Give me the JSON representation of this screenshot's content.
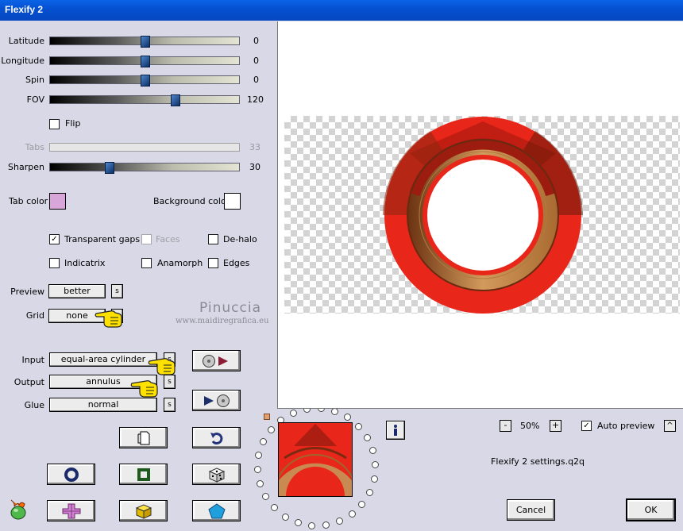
{
  "window": {
    "title": "Flexify 2"
  },
  "sliders": [
    {
      "label": "Latitude",
      "value": "0",
      "position": 0.5
    },
    {
      "label": "Longitude",
      "value": "0",
      "position": 0.5
    },
    {
      "label": "Spin",
      "value": "0",
      "position": 0.5
    },
    {
      "label": "FOV",
      "value": "120",
      "position": 0.66
    }
  ],
  "flip": {
    "label": "Flip",
    "checked": false
  },
  "tabs": {
    "label": "Tabs",
    "value": "33",
    "disabled": true
  },
  "sharpen": {
    "label": "Sharpen",
    "value": "30",
    "position": 0.3
  },
  "colors": {
    "tab_color_label": "Tab color",
    "tab_color": "#d9a6da",
    "background_color_label": "Background color",
    "background_color": "#ffffff"
  },
  "options": {
    "transparent_gaps": "Transparent gaps",
    "faces": "Faces",
    "de_halo": "De-halo",
    "indicatrix": "Indicatrix",
    "anamorph": "Anamorph",
    "edges": "Edges"
  },
  "preview_mode": {
    "label": "Preview",
    "value": "better"
  },
  "grid": {
    "label": "Grid",
    "value": "none"
  },
  "input": {
    "label": "Input",
    "value": "equal-area cylinder"
  },
  "output": {
    "label": "Output",
    "value": "annulus"
  },
  "glue": {
    "label": "Glue",
    "value": "normal"
  },
  "s_button": "s",
  "watermark": {
    "line1": "Pinuccia",
    "line2": "www.maidiregrafica.eu"
  },
  "zoom": {
    "minus": "-",
    "value": "50%",
    "plus": "+"
  },
  "auto_preview": {
    "label": "Auto preview",
    "checked": true,
    "caret": "^"
  },
  "settings_file": "Flexify 2 settings.q2q",
  "buttons": {
    "cancel": "Cancel",
    "ok": "OK"
  },
  "icons": {
    "new": "page-icon",
    "undo": "undo-icon",
    "ring": "ring-icon",
    "square": "square-icon",
    "dice": "dice-icon",
    "cross": "cross-icon",
    "cube": "cube-icon",
    "pentagon": "pentagon-icon",
    "info": "info-icon",
    "logo": "flaming-pear-icon"
  },
  "accent": {
    "titlebar": "#0551d2",
    "ring_red": "#e8261a",
    "ring_tan": "#d29a5c"
  }
}
